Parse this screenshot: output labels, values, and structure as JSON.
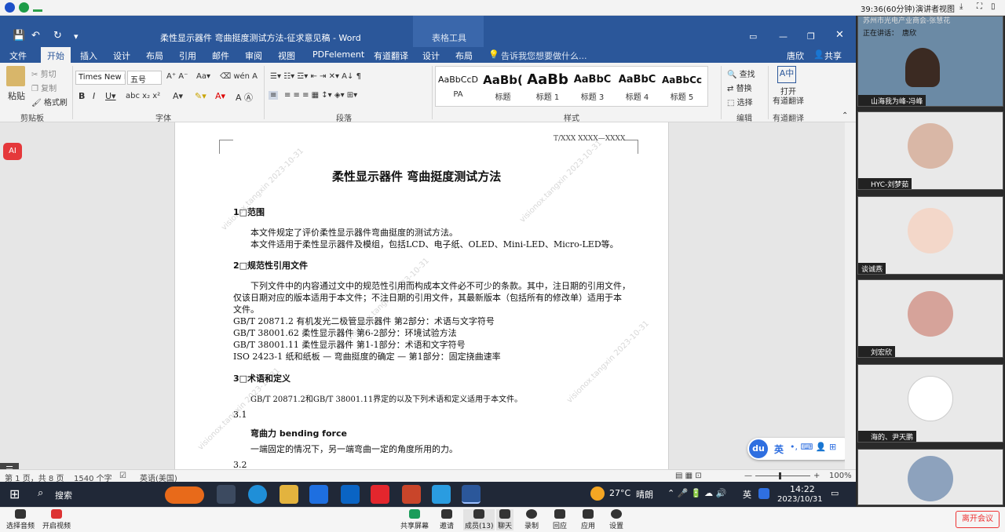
{
  "meeting_top": {
    "timer": "39:36(60分钟)",
    "view_mode": "演讲者视图"
  },
  "word": {
    "title": "柔性显示器件 弯曲挺度测试方法-征求意见稿 - Word",
    "tool_context": "表格工具",
    "user": "唐欣",
    "share": "共享",
    "tabs": [
      "文件",
      "开始",
      "插入",
      "设计",
      "布局",
      "引用",
      "邮件",
      "审阅",
      "视图",
      "PDFelement",
      "有道翻译",
      "设计",
      "布局"
    ],
    "tell_me": "告诉我您想要做什么...",
    "ribbon": {
      "paste": "粘贴",
      "cut": "剪切",
      "copy": "复制",
      "format_painter": "格式刷",
      "font_name": "Times New F",
      "font_size": "五号",
      "styles": [
        {
          "preview": "AaBbCcD",
          "name": "PA"
        },
        {
          "preview": "AaBb(",
          "name": "标题"
        },
        {
          "preview": "AaBb",
          "name": "标题 1"
        },
        {
          "preview": "AaBbC",
          "name": "标题 3"
        },
        {
          "preview": "AaBbC",
          "name": "标题 4"
        },
        {
          "preview": "AaBbCc",
          "name": "标题 5"
        }
      ],
      "find": "查找",
      "replace": "替换",
      "select": "选择",
      "open_youdao": "打开",
      "youdao_translate": "有道翻译",
      "groups": {
        "clipboard": "剪贴板",
        "font": "字体",
        "paragraph": "段落",
        "styles": "样式",
        "editing": "编辑",
        "youdao": "有道翻译"
      }
    },
    "doc": {
      "header_code": "T/XXX XXXX—XXXX",
      "title": "柔性显示器件 弯曲挺度测试方法",
      "s1": "1□范围",
      "s1_p1": "本文件规定了评价柔性显示器件弯曲挺度的测试方法。",
      "s1_p2": "本文件适用于柔性显示器件及模组，包括LCD、电子纸、OLED、Mini-LED、Micro-LED等。",
      "s2": "2□规范性引用文件",
      "s2_p1a": "下列文件中的内容通过文中的规范性引用而构成本文件必不可少的条款。其中，注日期的引用文件，",
      "s2_p1b": "仅该日期对应的版本适用于本文件；不注日期的引用文件，其最新版本（包括所有的修改单）适用于本",
      "s2_p1c": "文件。",
      "refs": [
        "GB/T 20871.2  有机发光二极管显示器件 第2部分：术语与文字符号",
        "GB/T 38001.62  柔性显示器件 第6-2部分：环境试验方法",
        "GB/T 38001.11  柔性显示器件 第1-1部分：术语和文字符号",
        "ISO 2423-1  纸和纸板 — 弯曲挺度的确定 — 第1部分：固定挠曲速率"
      ],
      "s3": "3□术语和定义",
      "s3_p1": "GB/T 20871.2和GB/T 38001.11界定的以及下列术语和定义适用于本文件。",
      "s31": "3.1",
      "term": "弯曲力  bending force",
      "term_def": "一端固定的情况下，另一端弯曲一定的角度所用的力。",
      "s32": "3.2"
    },
    "status": {
      "page": "第 1 页，共 8 页",
      "words": "1540 个字",
      "lang": "英语(美国)",
      "zoom": "100%"
    },
    "ime": "英"
  },
  "taskbar": {
    "search": "搜索",
    "weather_temp": "27°C",
    "weather_desc": "晴朗",
    "ime": "英",
    "time": "14:22",
    "date": "2023/10/31"
  },
  "participants": {
    "speaking_prefix": "正在讲话：",
    "speaking": "唐欣",
    "top_label": "苏州市光电产业商会-张慧花",
    "list": [
      "山海我为峰-冯峰",
      "HYC-刘梦茹",
      "谈诚燕",
      "刘宏欣",
      "海的、尹天鹏"
    ]
  },
  "meeting_bottom": {
    "audio": "选择音频",
    "video": "开启视频",
    "share": "共享屏幕",
    "invite": "邀请",
    "members": "成员(13)",
    "chat": "聊天",
    "record": "录制",
    "reaction": "回应",
    "apps": "应用",
    "settings": "设置",
    "leave": "离开会议"
  },
  "watermark": "visionox.tangxin 2023-10-31",
  "colors": {
    "word_blue": "#2b579a",
    "leave_red": "#e33333"
  }
}
